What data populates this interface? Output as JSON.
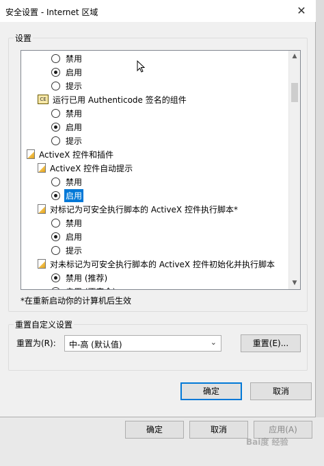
{
  "window": {
    "title": "安全设置 - Internet 区域",
    "close_glyph": "✕"
  },
  "settings_group": {
    "label": "设置"
  },
  "list": {
    "rows": [
      {
        "type": "radio",
        "label": "禁用",
        "checked": false
      },
      {
        "type": "radio",
        "label": "启用",
        "checked": true
      },
      {
        "type": "radio",
        "label": "提示",
        "checked": false
      },
      {
        "type": "cert",
        "label": "运行已用 Authenticode 签名的组件",
        "icon": "cert-icon",
        "icon_text": "CE"
      },
      {
        "type": "radio",
        "label": "禁用",
        "checked": false
      },
      {
        "type": "radio",
        "label": "启用",
        "checked": true
      },
      {
        "type": "radio",
        "label": "提示",
        "checked": false
      },
      {
        "type": "folder",
        "label": "ActiveX 控件和插件",
        "icon": "folder-icon"
      },
      {
        "type": "folder",
        "label": "ActiveX 控件自动提示",
        "icon": "setting-icon"
      },
      {
        "type": "radio",
        "label": "禁用",
        "checked": false
      },
      {
        "type": "radio",
        "label": "启用",
        "checked": true,
        "selected": true
      },
      {
        "type": "folder",
        "label": "对标记为可安全执行脚本的 ActiveX 控件执行脚本*",
        "icon": "setting-icon"
      },
      {
        "type": "radio",
        "label": "禁用",
        "checked": false
      },
      {
        "type": "radio",
        "label": "启用",
        "checked": true
      },
      {
        "type": "radio",
        "label": "提示",
        "checked": false
      },
      {
        "type": "folder",
        "label": "对未标记为可安全执行脚本的 ActiveX 控件初始化并执行脚本",
        "icon": "setting-icon"
      },
      {
        "type": "radio",
        "label": "禁用 (推荐)",
        "checked": true
      },
      {
        "type": "radio",
        "label": "启用 (不安全)",
        "checked": false
      }
    ],
    "scroll_up": "▲",
    "scroll_down": "▼"
  },
  "note": "*在重新启动你的计算机后生效",
  "reset_group": {
    "label": "重置自定义设置",
    "reset_to_label": "重置为(R):",
    "combo_value": "中-高 (默认值)",
    "combo_chevron": "⌄",
    "reset_button": "重置(E)..."
  },
  "dialog_buttons": {
    "ok": "确定",
    "cancel": "取消"
  },
  "background_buttons": {
    "ok": "确定",
    "cancel": "取消",
    "apply": "应用(A)"
  },
  "watermark": "Bai度 经验"
}
